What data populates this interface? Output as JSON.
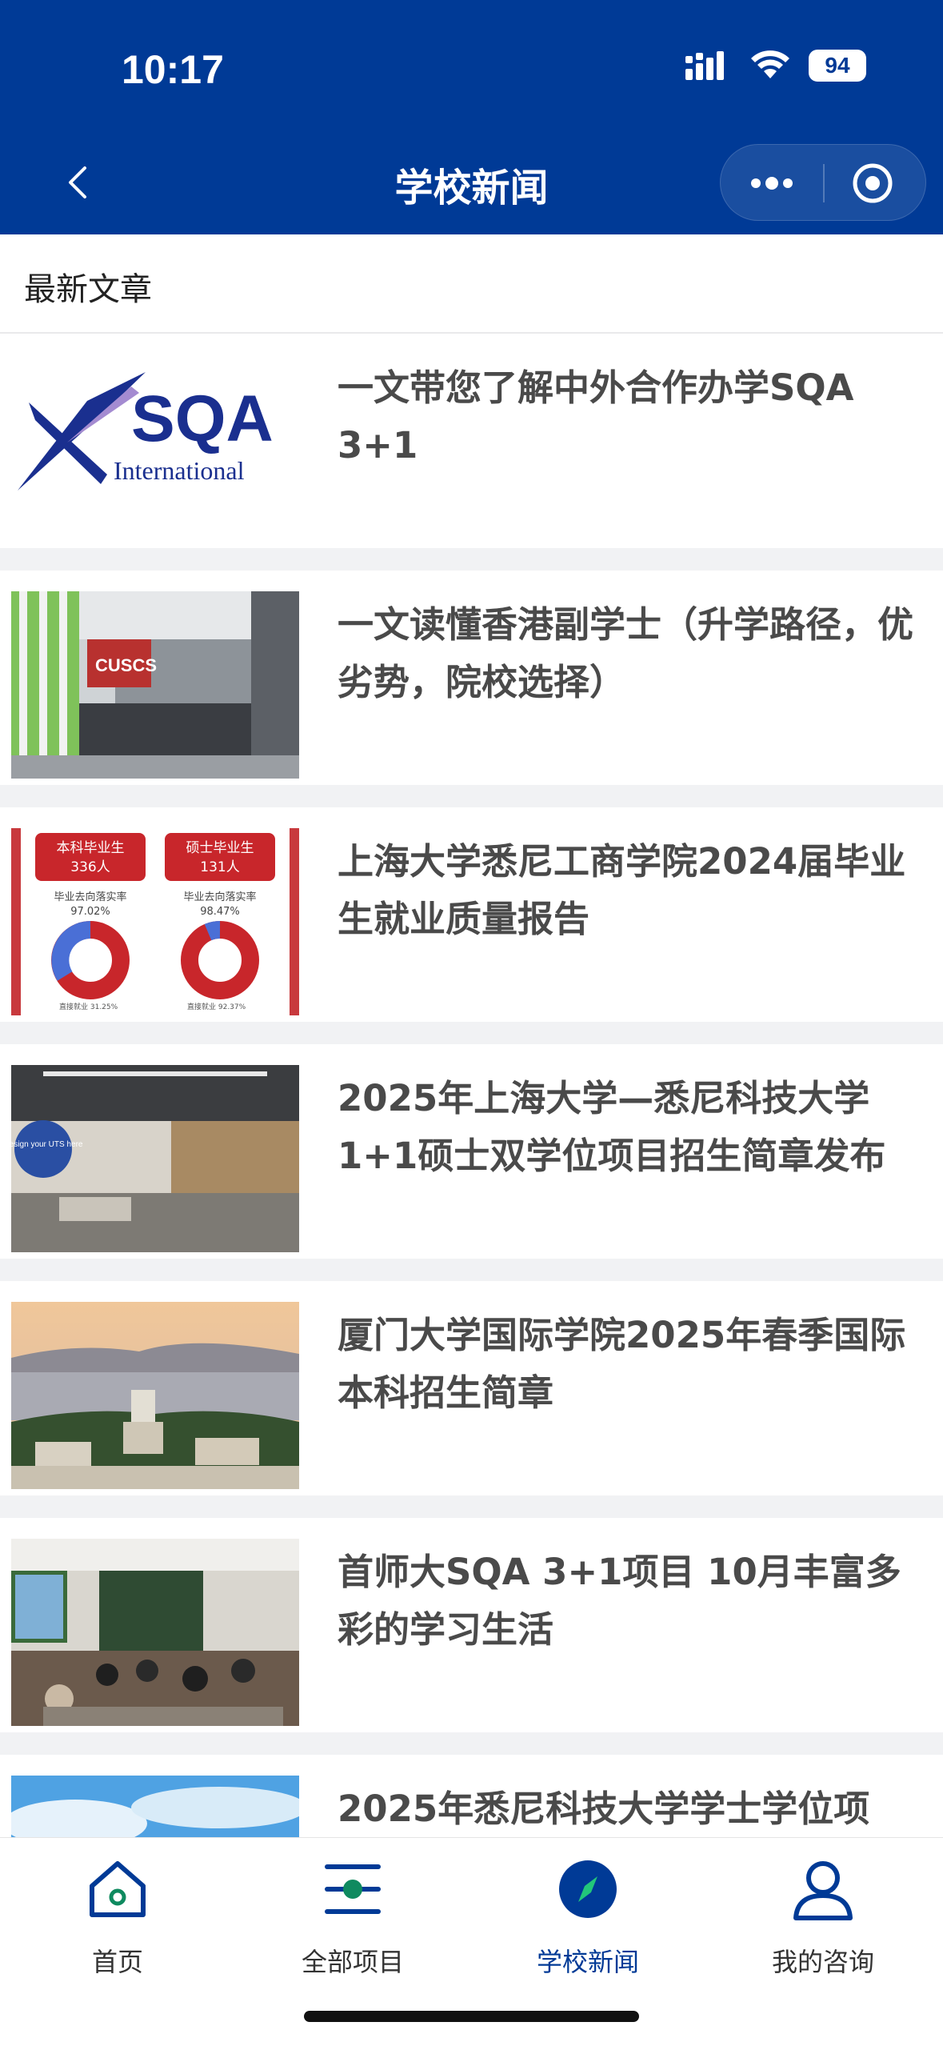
{
  "status_bar": {
    "time": "10:17",
    "battery": "94"
  },
  "nav": {
    "title": "学校新闻"
  },
  "section": {
    "header": "最新文章"
  },
  "articles": [
    {
      "title": "一文带您了解中外合作办学SQA 3+1",
      "thumb_logo_main": "SQA",
      "thumb_logo_sub": "International"
    },
    {
      "title": "一文读懂香港副学士（升学路径，优劣势，院校选择）",
      "thumb_sign": "CUSCS"
    },
    {
      "title": "上海大学悉尼工商学院2024届毕业生就业质量报告",
      "thumb_left_head": "本科毕业生",
      "thumb_left_count": "336人",
      "thumb_left_rate_label": "毕业去向落实率",
      "thumb_left_rate": "97.02%",
      "thumb_left_note": "直接就业 31.25%",
      "thumb_right_head": "硕士毕业生",
      "thumb_right_count": "131人",
      "thumb_right_rate_label": "毕业去向落实率",
      "thumb_right_rate": "98.47%",
      "thumb_right_note": "直接就业 92.37%"
    },
    {
      "title": "2025年上海大学—悉尼科技大学1+1硕士双学位项目招生简章发布",
      "thumb_sign": "Design your UTS here"
    },
    {
      "title": "厦门大学国际学院2025年春季国际本科招生简章"
    },
    {
      "title": "首师大SQA 3+1项目 10月丰富多彩的学习生活"
    },
    {
      "title": "2025年悉尼科技大学学士学位项"
    }
  ],
  "tabs": [
    {
      "label": "首页",
      "icon": "home-icon"
    },
    {
      "label": "全部项目",
      "icon": "filter-icon"
    },
    {
      "label": "学校新闻",
      "icon": "compass-icon",
      "active": true
    },
    {
      "label": "我的咨询",
      "icon": "user-icon"
    }
  ],
  "colors": {
    "brand": "#003a96",
    "background": "#f1f2f4",
    "title_text": "#4a4a4a"
  }
}
